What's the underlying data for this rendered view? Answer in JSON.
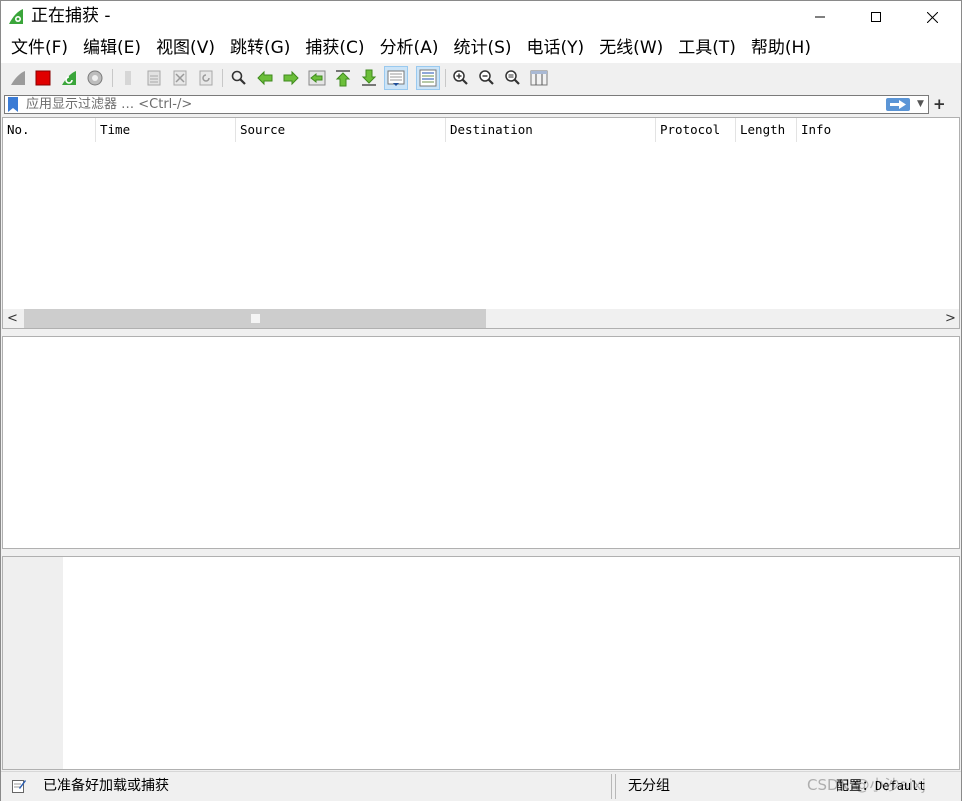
{
  "window": {
    "title": "正在捕获 -",
    "controls": {
      "minimize": "—",
      "maximize": "☐",
      "close": "✕"
    }
  },
  "menu": [
    {
      "label": "文件(F)",
      "name": "menu-file"
    },
    {
      "label": "编辑(E)",
      "name": "menu-edit"
    },
    {
      "label": "视图(V)",
      "name": "menu-view"
    },
    {
      "label": "跳转(G)",
      "name": "menu-go"
    },
    {
      "label": "捕获(C)",
      "name": "menu-capture"
    },
    {
      "label": "分析(A)",
      "name": "menu-analyze"
    },
    {
      "label": "统计(S)",
      "name": "menu-statistics"
    },
    {
      "label": "电话(Y)",
      "name": "menu-telephony"
    },
    {
      "label": "无线(W)",
      "name": "menu-wireless"
    },
    {
      "label": "工具(T)",
      "name": "menu-tools"
    },
    {
      "label": "帮助(H)",
      "name": "menu-help"
    }
  ],
  "toolbar": {
    "icons": [
      "start-capture-icon",
      "stop-capture-icon",
      "restart-capture-icon",
      "capture-options-icon",
      "open-file-icon",
      "save-file-icon",
      "close-file-icon",
      "reload-file-icon",
      "find-packet-icon",
      "go-back-icon",
      "go-forward-icon",
      "go-to-packet-icon",
      "go-first-icon",
      "go-last-icon",
      "autoscroll-icon",
      "colorize-icon",
      "zoom-in-icon",
      "zoom-out-icon",
      "zoom-normal-icon",
      "resize-columns-icon"
    ],
    "pressed": [
      "autoscroll-icon",
      "colorize-icon"
    ]
  },
  "filter": {
    "placeholder": "应用显示过滤器 … <Ctrl-/>",
    "plus": "+"
  },
  "packet_list": {
    "columns": [
      "No.",
      "Time",
      "Source",
      "Destination",
      "Protocol",
      "Length",
      "Info"
    ],
    "rows": [],
    "scroll_left": "<",
    "scroll_right": ">"
  },
  "status": {
    "message": "已准备好加载或捕获",
    "packets": "无分组",
    "profile_label": "配置：",
    "profile_value": "Default",
    "watermark": "CSDN @小沙aixj"
  },
  "colors": {
    "accent": "#3a9bdc",
    "shark_green": "#3aa53a",
    "stop_red": "#e00000"
  }
}
